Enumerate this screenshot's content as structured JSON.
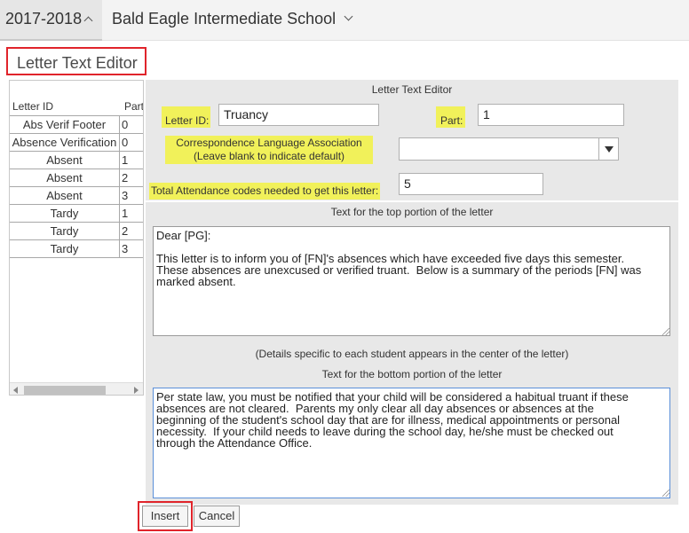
{
  "topbar": {
    "year": "2017-2018",
    "school": "Bald Eagle Intermediate School"
  },
  "page_title": "Letter Text Editor",
  "letter_list": {
    "columns": [
      "Letter ID",
      "Part"
    ],
    "rows": [
      {
        "id": "Abs Verif Footer",
        "part": "0"
      },
      {
        "id": "Absence Verification",
        "part": "0"
      },
      {
        "id": "Absent",
        "part": "1"
      },
      {
        "id": "Absent",
        "part": "2"
      },
      {
        "id": "Absent",
        "part": "3"
      },
      {
        "id": "Tardy",
        "part": "1"
      },
      {
        "id": "Tardy",
        "part": "2"
      },
      {
        "id": "Tardy",
        "part": "3"
      }
    ]
  },
  "editor": {
    "heading": "Letter Text Editor",
    "letter_id_label": "Letter ID:",
    "letter_id_value": "Truancy",
    "part_label": "Part:",
    "part_value": "1",
    "lang_label_1": "Correspondence Language Association",
    "lang_label_2": "(Leave blank to indicate default)",
    "lang_value": "",
    "codes_label": "Total Attendance codes needed to get this letter:",
    "codes_value": "5",
    "top_heading": "Text for the top portion of the letter",
    "top_text": "Dear [PG]:\n\nThis letter is to inform you of [FN]'s absences which have exceeded five days this semester.\nThese absences are unexcused or verified truant.  Below is a summary of the periods [FN] was\nmarked absent.",
    "center_note": "(Details specific to each student appears in the center of the letter)",
    "bottom_heading": "Text for the bottom portion of the letter",
    "bottom_text": "Per state law, you must be notified that your child will be considered a habitual truant if these\nabsences are not cleared.  Parents my only clear all day absences or absences at the\nbeginning of the student's school day that are for illness, medical appointments or personal\nnecessity.  If your child needs to leave during the school day, he/she must be checked out\nthrough the Attendance Office."
  },
  "buttons": {
    "insert": "Insert",
    "cancel": "Cancel"
  },
  "colors": {
    "highlight": "#f1f15a",
    "annotation": "#e0242b"
  }
}
